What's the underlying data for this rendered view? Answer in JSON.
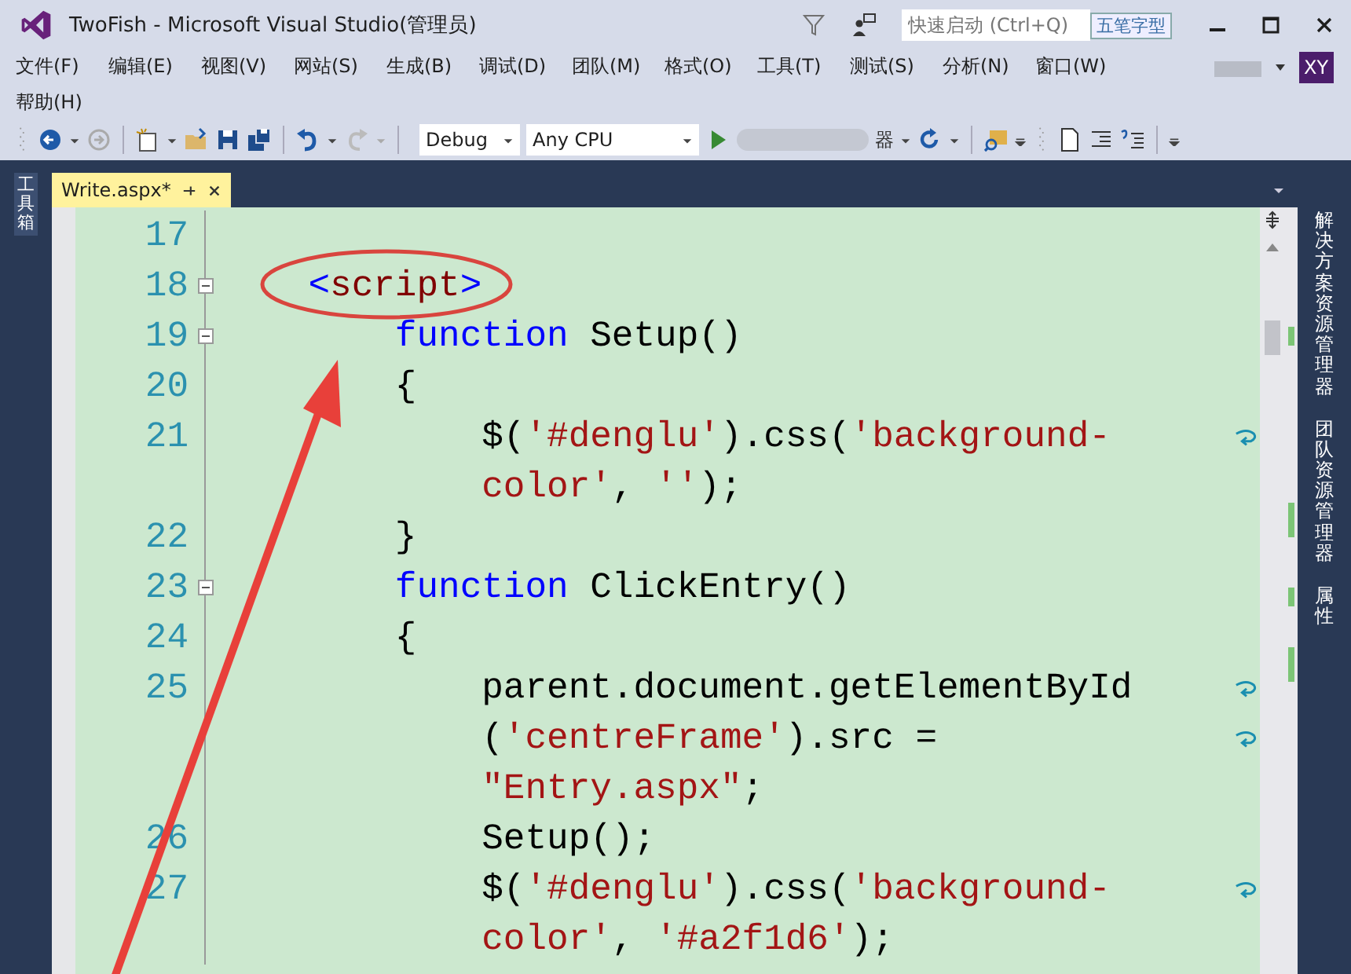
{
  "window": {
    "title": "TwoFish - Microsoft Visual Studio(管理员)",
    "quick_launch": {
      "placeholder": "快速启动 (Ctrl+Q)"
    },
    "ime_indicator": "五笔字型",
    "user_initials": "XY"
  },
  "menu": [
    "文件(F)",
    "编辑(E)",
    "视图(V)",
    "网站(S)",
    "生成(B)",
    "调试(D)",
    "团队(M)",
    "格式(O)",
    "工具(T)",
    "测试(S)",
    "分析(N)",
    "窗口(W)",
    "帮助(H)"
  ],
  "toolbar": {
    "configuration": "Debug",
    "platform": "Any CPU",
    "run_target_tail": "器"
  },
  "left_tool_tabs": [
    "工具箱"
  ],
  "document_tabs": [
    {
      "label": "Write.aspx*",
      "selected": true
    }
  ],
  "right_tool_tabs": [
    "解决方案资源管理器",
    "团队资源管理器",
    "属性"
  ],
  "code_lines": [
    {
      "number": "17",
      "foldable": false,
      "wrapped": false
    },
    {
      "number": "18",
      "foldable": true,
      "wrapped": false,
      "tokens": [
        {
          "kind": "tag-bracket",
          "text": "    <"
        },
        {
          "kind": "tag-name",
          "text": "script"
        },
        {
          "kind": "tag-bracket",
          "text": ">"
        }
      ]
    },
    {
      "number": "19",
      "foldable": true,
      "wrapped": false,
      "tokens": [
        {
          "kind": "keyword",
          "text": "        function"
        },
        {
          "kind": "plain",
          "text": " Setup()"
        }
      ]
    },
    {
      "number": "20",
      "foldable": false,
      "wrapped": false,
      "tokens": [
        {
          "kind": "plain",
          "text": "        {"
        }
      ]
    },
    {
      "number": "21",
      "foldable": false,
      "wrapped": true,
      "tokens": [
        {
          "kind": "plain",
          "text": "            $("
        },
        {
          "kind": "string",
          "text": "'#denglu'"
        },
        {
          "kind": "plain",
          "text": ").css("
        },
        {
          "kind": "string",
          "text": "'background-"
        }
      ]
    },
    {
      "foldable": false,
      "wrapped": false,
      "tokens": [
        {
          "kind": "string",
          "text": "            color'"
        },
        {
          "kind": "plain",
          "text": ", "
        },
        {
          "kind": "string",
          "text": "''"
        },
        {
          "kind": "plain",
          "text": ");"
        }
      ]
    },
    {
      "number": "22",
      "foldable": false,
      "wrapped": false,
      "tokens": [
        {
          "kind": "plain",
          "text": "        }"
        }
      ]
    },
    {
      "number": "23",
      "foldable": true,
      "wrapped": false,
      "tokens": [
        {
          "kind": "keyword",
          "text": "        function"
        },
        {
          "kind": "plain",
          "text": " ClickEntry()"
        }
      ]
    },
    {
      "number": "24",
      "foldable": false,
      "wrapped": false,
      "tokens": [
        {
          "kind": "plain",
          "text": "        {"
        }
      ]
    },
    {
      "number": "25",
      "foldable": false,
      "wrapped": true,
      "tokens": [
        {
          "kind": "plain",
          "text": "            parent.document.getElementById"
        }
      ]
    },
    {
      "foldable": false,
      "wrapped": true,
      "tokens": [
        {
          "kind": "plain",
          "text": "            ("
        },
        {
          "kind": "string",
          "text": "'centreFrame'"
        },
        {
          "kind": "plain",
          "text": ").src ="
        }
      ]
    },
    {
      "foldable": false,
      "wrapped": false,
      "tokens": [
        {
          "kind": "string",
          "text": "            \"Entry.aspx\""
        },
        {
          "kind": "plain",
          "text": ";"
        }
      ]
    },
    {
      "number": "26",
      "foldable": false,
      "wrapped": false,
      "tokens": [
        {
          "kind": "plain",
          "text": "            Setup();"
        }
      ]
    },
    {
      "number": "27",
      "foldable": false,
      "wrapped": true,
      "tokens": [
        {
          "kind": "plain",
          "text": "            $("
        },
        {
          "kind": "string",
          "text": "'#denglu'"
        },
        {
          "kind": "plain",
          "text": ").css("
        },
        {
          "kind": "string",
          "text": "'background-"
        }
      ]
    },
    {
      "foldable": false,
      "wrapped": false,
      "tokens": [
        {
          "kind": "string",
          "text": "            color'"
        },
        {
          "kind": "plain",
          "text": ", "
        },
        {
          "kind": "string",
          "text": "'#a2f1d6'"
        },
        {
          "kind": "plain",
          "text": ");"
        }
      ]
    }
  ]
}
